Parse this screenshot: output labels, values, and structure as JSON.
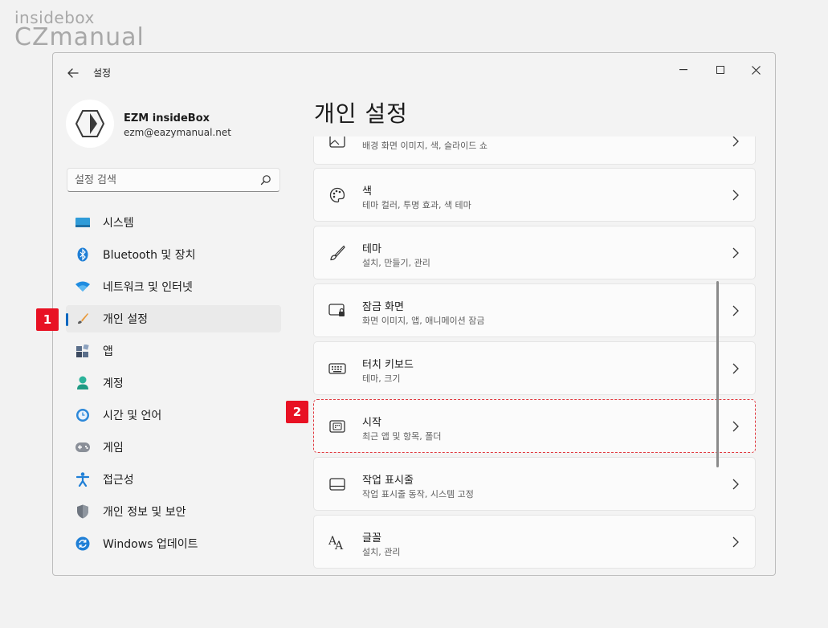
{
  "watermark": {
    "top": "insidebox",
    "main": "CZmanual"
  },
  "window": {
    "title": "설정"
  },
  "profile": {
    "name": "EZM insideBox",
    "email": "ezm@eazymanual.net"
  },
  "search": {
    "placeholder": "설정 검색"
  },
  "nav": {
    "items": [
      {
        "label": "시스템",
        "icon": "system-icon"
      },
      {
        "label": "Bluetooth 및 장치",
        "icon": "bluetooth-icon"
      },
      {
        "label": "네트워크 및 인터넷",
        "icon": "wifi-icon"
      },
      {
        "label": "개인 설정",
        "icon": "brush-icon",
        "selected": true
      },
      {
        "label": "앱",
        "icon": "apps-icon"
      },
      {
        "label": "계정",
        "icon": "account-icon"
      },
      {
        "label": "시간 및 언어",
        "icon": "time-language-icon"
      },
      {
        "label": "게임",
        "icon": "gamepad-icon"
      },
      {
        "label": "접근성",
        "icon": "accessibility-icon"
      },
      {
        "label": "개인 정보 및 보안",
        "icon": "shield-icon"
      },
      {
        "label": "Windows 업데이트",
        "icon": "update-icon"
      }
    ]
  },
  "page": {
    "title": "개인 설정"
  },
  "cards": [
    {
      "title": "",
      "subtitle": "배경 화면 이미지, 색, 슬라이드 쇼",
      "icon": "image-icon"
    },
    {
      "title": "색",
      "subtitle": "테마 컬러, 투명 효과, 색 테마",
      "icon": "palette-icon"
    },
    {
      "title": "테마",
      "subtitle": "설치, 만들기, 관리",
      "icon": "brush-icon"
    },
    {
      "title": "잠금 화면",
      "subtitle": "화면 이미지, 앱, 애니메이션 잠금",
      "icon": "lock-screen-icon"
    },
    {
      "title": "터치 키보드",
      "subtitle": "테마, 크기",
      "icon": "keyboard-icon"
    },
    {
      "title": "시작",
      "subtitle": "최근 앱 및 항목, 폴더",
      "icon": "start-icon"
    },
    {
      "title": "작업 표시줄",
      "subtitle": "작업 표시줄 동작, 시스템 고정",
      "icon": "taskbar-icon"
    },
    {
      "title": "글꼴",
      "subtitle": "설치, 관리",
      "icon": "fonts-icon"
    }
  ],
  "badges": {
    "one": "1",
    "two": "2"
  },
  "colors": {
    "accent": "#0067c0",
    "badge": "#e81123",
    "highlight": "#e0383e"
  }
}
